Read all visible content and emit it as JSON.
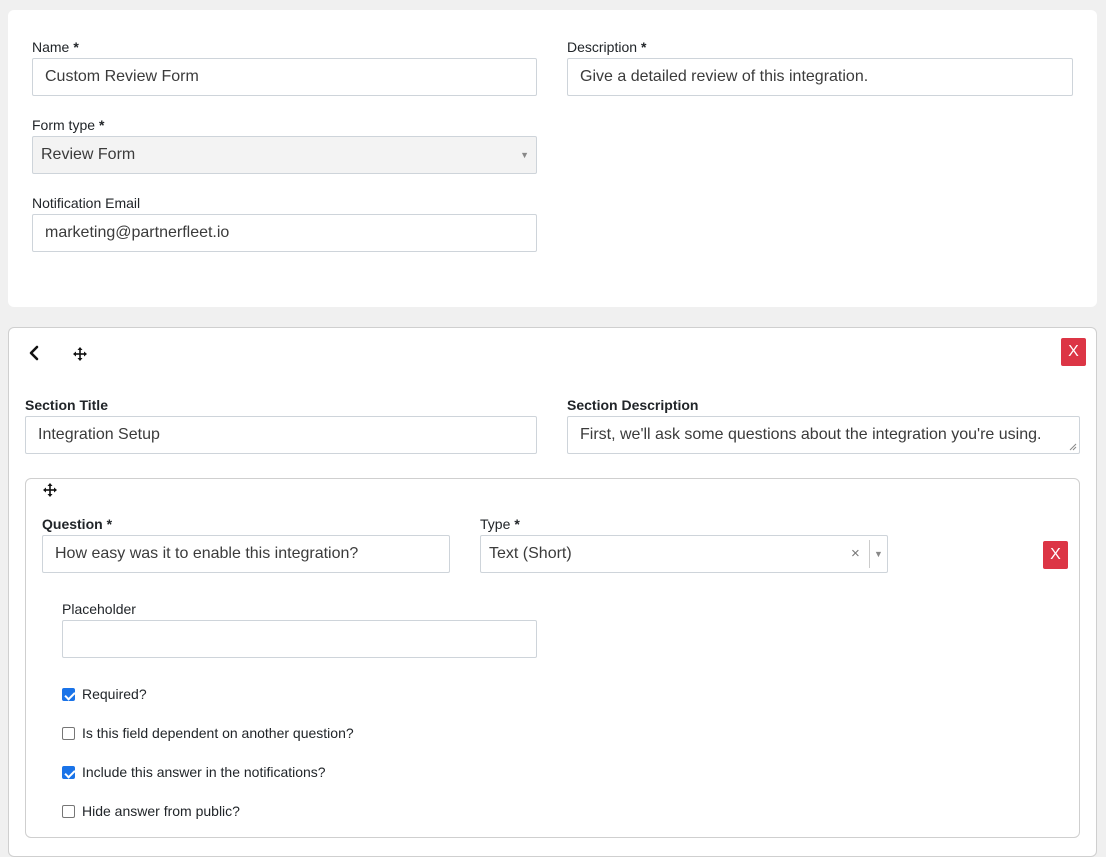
{
  "form": {
    "name_label": "Name",
    "name_value": "Custom Review Form",
    "description_label": "Description",
    "description_value": "Give a detailed review of this integration.",
    "form_type_label": "Form type",
    "form_type_value": "Review Form",
    "notification_email_label": "Notification Email",
    "notification_email_value": "marketing@partnerfleet.io",
    "required_marker": "*"
  },
  "section": {
    "title_label": "Section Title",
    "title_value": "Integration Setup",
    "description_label": "Section Description",
    "description_value": "First, we'll ask some questions about the integration you're using.",
    "remove_label": "X"
  },
  "question": {
    "question_label": "Question",
    "question_value": "How easy was it to enable this integration?",
    "type_label": "Type",
    "type_value": "Text (Short)",
    "clear_glyph": "×",
    "remove_label": "X",
    "placeholder_label": "Placeholder",
    "placeholder_value": "",
    "options": [
      {
        "label": "Required?",
        "checked": true
      },
      {
        "label": "Is this field dependent on another question?",
        "checked": false
      },
      {
        "label": "Include this answer in the notifications?",
        "checked": true
      },
      {
        "label": "Hide answer from public?",
        "checked": false
      }
    ]
  },
  "icons": {
    "back": "chevron-left-icon",
    "move": "move-arrows-icon",
    "dropdown": "caret-down-icon"
  },
  "colors": {
    "danger": "#dc3545",
    "checkbox_checked": "#1a73e8",
    "page_background": "#f0f0f0"
  }
}
